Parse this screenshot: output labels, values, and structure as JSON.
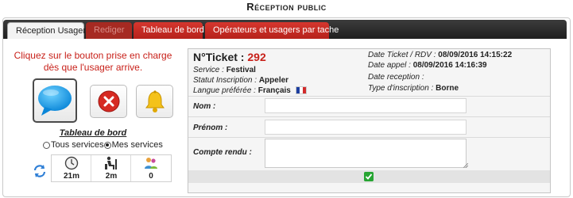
{
  "page": {
    "title": "Réception public"
  },
  "tabs": [
    {
      "label": "Réception Usager",
      "state": "active"
    },
    {
      "label": "Rediger",
      "state": "disabled"
    },
    {
      "label": "Tableau de bord",
      "state": "normal"
    },
    {
      "label": "Opérateurs et usagers par tache",
      "state": "normal"
    }
  ],
  "left": {
    "prompt": "Cliquez sur le bouton prise en charge dès que l'usager arrive.",
    "buttons": [
      {
        "icon": "chat-bubble-icon"
      },
      {
        "icon": "cancel-icon"
      },
      {
        "icon": "bell-icon"
      }
    ],
    "dashboard_title": "Tableau de bord",
    "filter": {
      "all_label": "Tous services",
      "mine_label": "Mes services",
      "selected": "Mes services"
    },
    "stats": [
      {
        "icon": "clock-icon",
        "value": "21m"
      },
      {
        "icon": "waiting-person-icon",
        "value": "2m"
      },
      {
        "icon": "users-group-icon",
        "value": "0"
      }
    ]
  },
  "ticket": {
    "label": "N°Ticket :",
    "number": "292",
    "service_label": "Service :",
    "service_value": "Festival",
    "statut_label": "Statut Inscription :",
    "statut_value": "Appeler",
    "langue_label": "Langue préférée :",
    "langue_value": "Français",
    "date_ticket_label": "Date Ticket / RDV :",
    "date_ticket_value": "08/09/2016 14:15:22",
    "date_appel_label": "Date appel :",
    "date_appel_value": "08/09/2016 14:16:39",
    "date_reception_label": "Date reception :",
    "date_reception_value": "",
    "type_label": "Type d'inscription :",
    "type_value": "Borne"
  },
  "form": {
    "nom_label": "Nom :",
    "nom_value": "",
    "prenom_label": "Prénom :",
    "prenom_value": "",
    "compte_label": "Compte rendu :",
    "compte_value": ""
  },
  "colors": {
    "accent_red": "#c8211a",
    "tab_red": "#c52d24",
    "ok_green": "#27a533"
  }
}
